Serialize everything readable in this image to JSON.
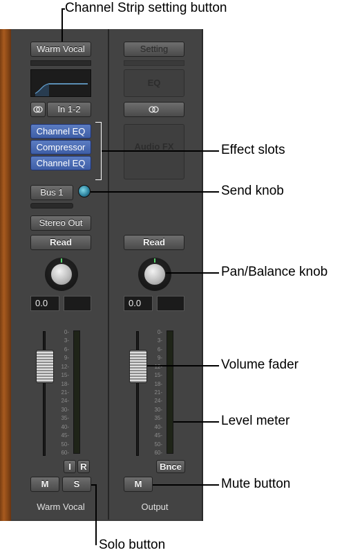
{
  "callouts": {
    "channel_strip_setting": "Channel Strip setting button",
    "effect_slots": "Effect slots",
    "send_knob": "Send knob",
    "pan_balance_knob": "Pan/Balance knob",
    "volume_fader": "Volume fader",
    "level_meter": "Level meter",
    "mute_button": "Mute button",
    "solo_button": "Solo button"
  },
  "strip1": {
    "setting_label": "Warm Vocal",
    "input_label": "In 1-2",
    "plugins": [
      "Channel EQ",
      "Compressor",
      "Channel EQ"
    ],
    "send_label": "Bus 1",
    "output_label": "Stereo Out",
    "automation_label": "Read",
    "volume_value": "0.0",
    "input_monitor_label": "I",
    "record_enable_label": "R",
    "mute_label": "M",
    "solo_label": "S",
    "name": "Warm Vocal",
    "fader_level_db": 0
  },
  "strip2": {
    "setting_label": "Setting",
    "eq_label": "EQ",
    "audio_fx_label": "Audio FX",
    "automation_label": "Read",
    "volume_value": "0.0",
    "bounce_label": "Bnce",
    "mute_label": "M",
    "name": "Output",
    "fader_level_db": 0
  },
  "meter_scale": [
    "0",
    "3",
    "6",
    "9",
    "12",
    "15",
    "18",
    "21",
    "24",
    "30",
    "35",
    "40",
    "45",
    "50",
    "60"
  ],
  "icons": {
    "stereo_link": "link-rings-icon"
  }
}
